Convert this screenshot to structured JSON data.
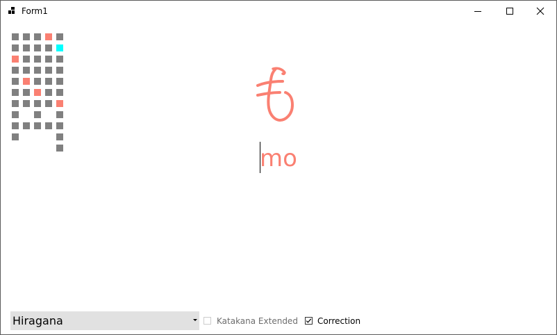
{
  "window": {
    "title": "Form1"
  },
  "colors": {
    "cell_default": "#808080",
    "cell_error": "#fa8072",
    "cell_current": "#00ffff",
    "kana": "#fa8072",
    "romaji": "#fa8072"
  },
  "kana_grid": {
    "columns": 5,
    "rows": [
      [
        "default",
        "default",
        "default",
        "error",
        "default"
      ],
      [
        "default",
        "default",
        "default",
        "default",
        "current"
      ],
      [
        "error",
        "default",
        "default",
        "default",
        "default"
      ],
      [
        "default",
        "default",
        "default",
        "default",
        "default"
      ],
      [
        "default",
        "error",
        "default",
        "default",
        "default"
      ],
      [
        "default",
        "default",
        "error",
        "default",
        "default"
      ],
      [
        "default",
        "default",
        "default",
        "default",
        "error"
      ],
      [
        "default",
        "empty",
        "default",
        "empty",
        "default"
      ],
      [
        "default",
        "default",
        "default",
        "default",
        "default"
      ],
      [
        "default",
        "empty",
        "empty",
        "empty",
        "default"
      ],
      [
        "empty",
        "empty",
        "empty",
        "empty",
        "default"
      ]
    ]
  },
  "quiz": {
    "kana": "も",
    "romaji": "mo"
  },
  "controls": {
    "script_select": {
      "value": "Hiragana"
    },
    "katakana_extended": {
      "label": "Katakana Extended",
      "checked": false,
      "enabled": false
    },
    "correction": {
      "label": "Correction",
      "checked": true,
      "enabled": true
    }
  }
}
